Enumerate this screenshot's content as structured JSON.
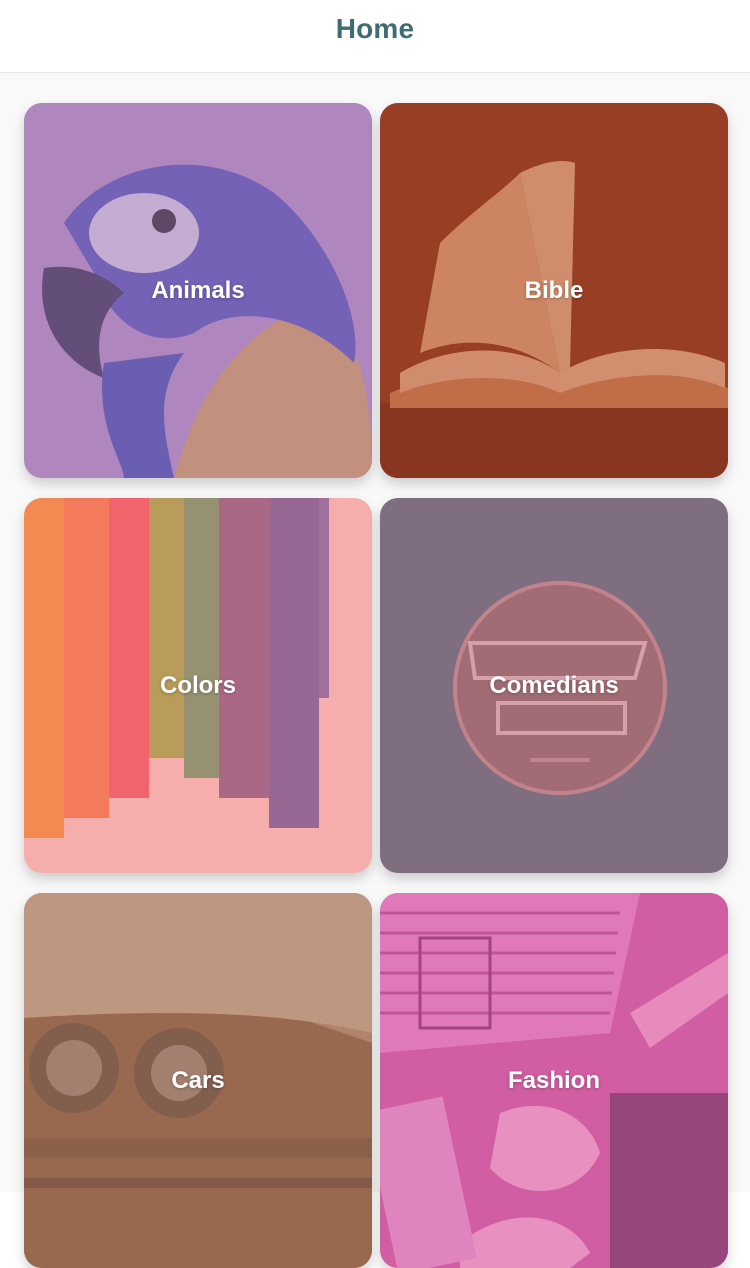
{
  "header": {
    "title": "Home"
  },
  "categories": [
    {
      "label": "Animals",
      "icon": "parrot-image",
      "overlay": "#a77ab8"
    },
    {
      "label": "Bible",
      "icon": "open-book-image",
      "overlay": "#a8452a"
    },
    {
      "label": "Colors",
      "icon": "paint-strokes-image",
      "overlay": "#f4a3a5"
    },
    {
      "label": "Comedians",
      "icon": "neon-comedy-club-image",
      "overlay": "#7f6e7f"
    },
    {
      "label": "Cars",
      "icon": "vintage-car-image",
      "overlay": "#b0846a"
    },
    {
      "label": "Fashion",
      "icon": "fashion-flatlay-image",
      "overlay": "#d25ea3"
    }
  ]
}
